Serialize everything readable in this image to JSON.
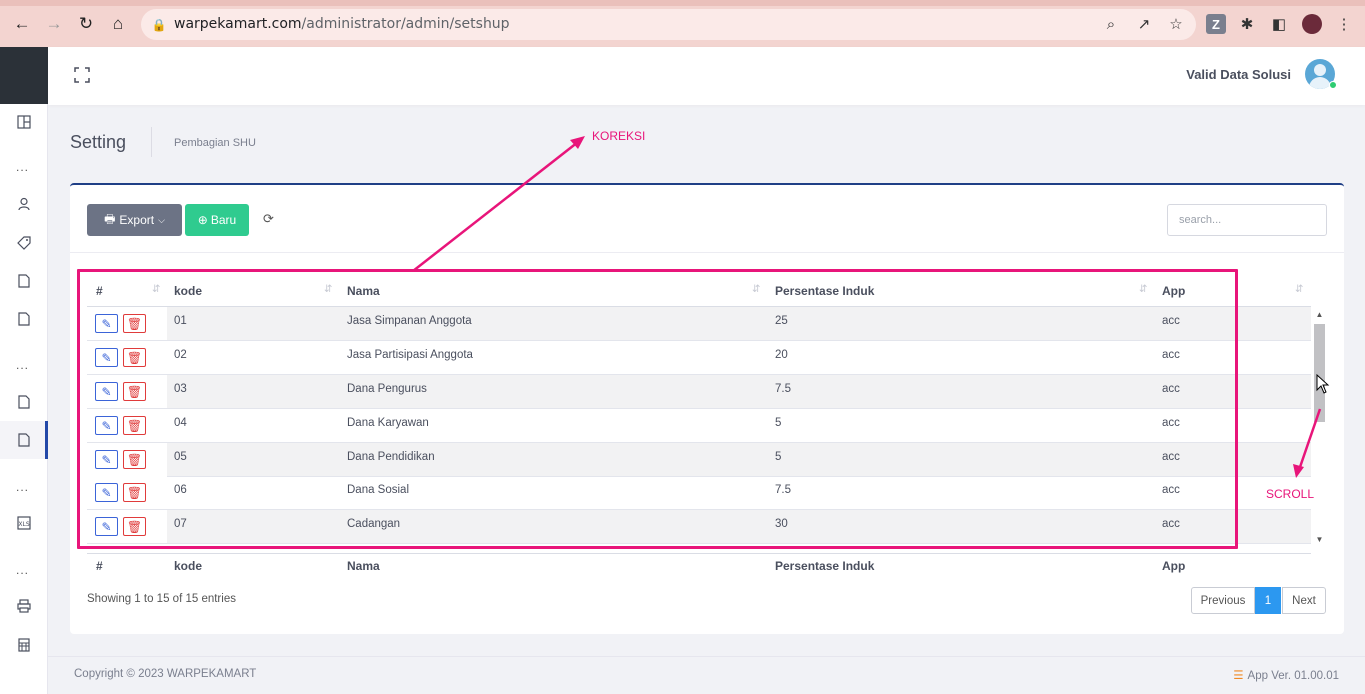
{
  "browser": {
    "url_host": "warpekamart.com",
    "url_path": "/administrator/admin/setshup"
  },
  "topbar": {
    "user_name": "Valid Data Solusi"
  },
  "page": {
    "title": "Setting",
    "subtitle": "Pembagian SHU"
  },
  "toolbar": {
    "export_label": "Export",
    "new_label": "Baru",
    "search_placeholder": "search..."
  },
  "table": {
    "columns": [
      "#",
      "kode",
      "Nama",
      "Persentase Induk",
      "App"
    ],
    "rows": [
      {
        "kode": "01",
        "nama": "Jasa Simpanan Anggota",
        "persentase": "25",
        "app": "acc"
      },
      {
        "kode": "02",
        "nama": "Jasa Partisipasi Anggota",
        "persentase": "20",
        "app": "acc"
      },
      {
        "kode": "03",
        "nama": "Dana Pengurus",
        "persentase": "7.5",
        "app": "acc"
      },
      {
        "kode": "04",
        "nama": "Dana Karyawan",
        "persentase": "5",
        "app": "acc"
      },
      {
        "kode": "05",
        "nama": "Dana Pendidikan",
        "persentase": "5",
        "app": "acc"
      },
      {
        "kode": "06",
        "nama": "Dana Sosial",
        "persentase": "7.5",
        "app": "acc"
      },
      {
        "kode": "07",
        "nama": "Cadangan",
        "persentase": "30",
        "app": "acc"
      }
    ],
    "info": "Showing 1 to 15 of 15 entries",
    "pagination": {
      "previous": "Previous",
      "current": "1",
      "next": "Next"
    }
  },
  "footer": {
    "copyright": "Copyright © 2023 WARPEKAMART",
    "version": "App Ver. 01.00.01"
  },
  "annotations": {
    "koreksi": "KOREKSI",
    "scroll": "SCROLL"
  },
  "colors": {
    "accent_blue": "#1f3f86",
    "btn_export": "#6c7385",
    "btn_new": "#2fcb8f",
    "pager_active": "#2c98f0",
    "annotation": "#e8157a"
  }
}
